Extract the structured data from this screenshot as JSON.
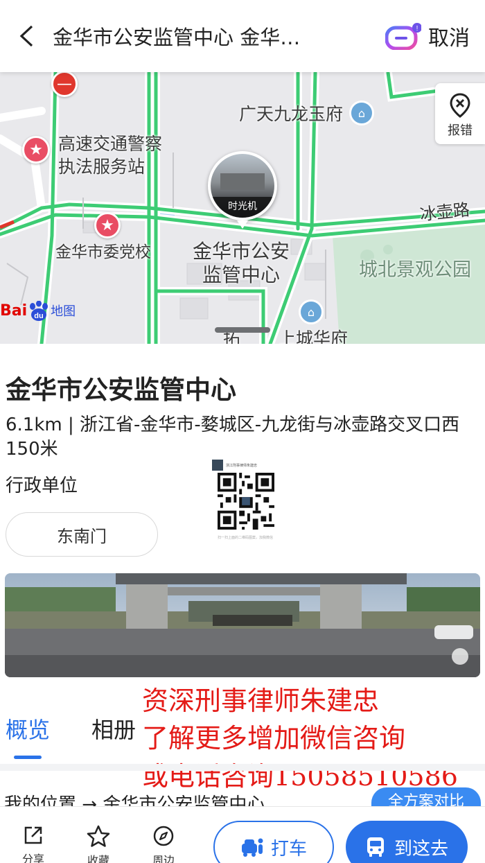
{
  "header": {
    "title": "金华市公安监管中心 金华…",
    "cancel_label": "取消"
  },
  "map": {
    "labels": {
      "guangtian": "广天九龙玉府",
      "highway_police_1": "高速交通警察",
      "highway_police_2": "执法服务站",
      "party_school": "金华市委党校",
      "center_1": "金华市公安",
      "center_2": "监管中心",
      "bingthu_road": "冰壶路",
      "park": "城北景观公园",
      "shangcheng": "上城华府",
      "tuo": "拓"
    },
    "time_machine_label": "时光机",
    "report_label": "报错",
    "logo_bai": "Bai",
    "logo_du": "du",
    "logo_ditu": "地图"
  },
  "place": {
    "name": "金华市公安监管中心",
    "address": "6.1km | 浙江省-金华市-婺城区-九龙街与冰壶路交叉口西150米",
    "type": "行政单位",
    "tag": "东南门"
  },
  "qr": {
    "name": "浙江刑事律师朱建忠",
    "footer": "扫一扫上面的二维码图案，加我微信"
  },
  "tabs": {
    "overview": "概览",
    "album": "相册"
  },
  "overlay": {
    "line1": "资深刑事律师朱建忠",
    "line2": "了解更多增加微信咨询",
    "line3": "或电话咨询15058510586"
  },
  "route": {
    "text": "我的位置 → 金华市公安监管中心",
    "compare_label": "全方案对比"
  },
  "bottom": {
    "share": "分享",
    "favorite": "收藏",
    "nearby": "周边",
    "taxi": "打车",
    "go": "到这去"
  },
  "colors": {
    "accent": "#2a72e8",
    "road_green": "#3dcc74",
    "overlay_red": "#e41b17"
  }
}
